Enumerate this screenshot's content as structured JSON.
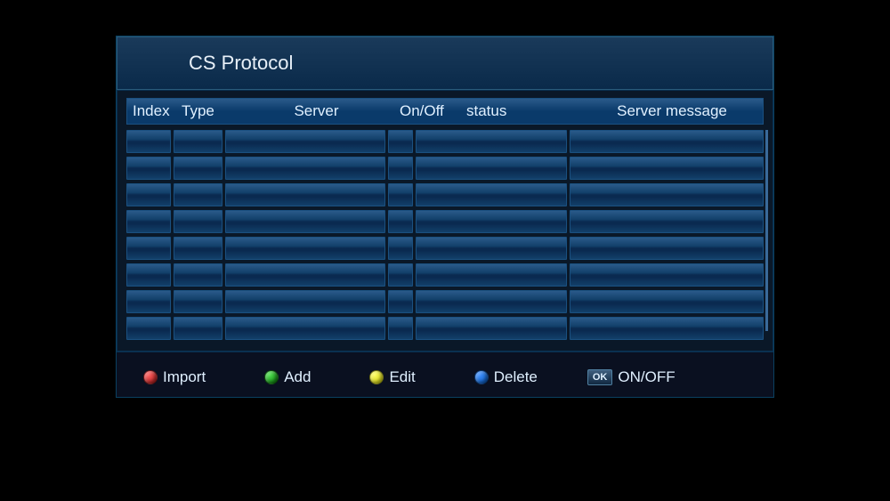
{
  "title": "CS Protocol",
  "columns": {
    "index": "Index",
    "type": "Type",
    "server": "Server",
    "onoff": "On/Off",
    "status": "status",
    "message": "Server message"
  },
  "rows": [
    {
      "index": "",
      "type": "",
      "server": "",
      "onoff": "",
      "status": "",
      "message": ""
    },
    {
      "index": "",
      "type": "",
      "server": "",
      "onoff": "",
      "status": "",
      "message": ""
    },
    {
      "index": "",
      "type": "",
      "server": "",
      "onoff": "",
      "status": "",
      "message": ""
    },
    {
      "index": "",
      "type": "",
      "server": "",
      "onoff": "",
      "status": "",
      "message": ""
    },
    {
      "index": "",
      "type": "",
      "server": "",
      "onoff": "",
      "status": "",
      "message": ""
    },
    {
      "index": "",
      "type": "",
      "server": "",
      "onoff": "",
      "status": "",
      "message": ""
    },
    {
      "index": "",
      "type": "",
      "server": "",
      "onoff": "",
      "status": "",
      "message": ""
    },
    {
      "index": "",
      "type": "",
      "server": "",
      "onoff": "",
      "status": "",
      "message": ""
    }
  ],
  "actions": {
    "import": "Import",
    "add": "Add",
    "edit": "Edit",
    "delete": "Delete",
    "onoff_badge": "OK",
    "onoff": "ON/OFF"
  }
}
